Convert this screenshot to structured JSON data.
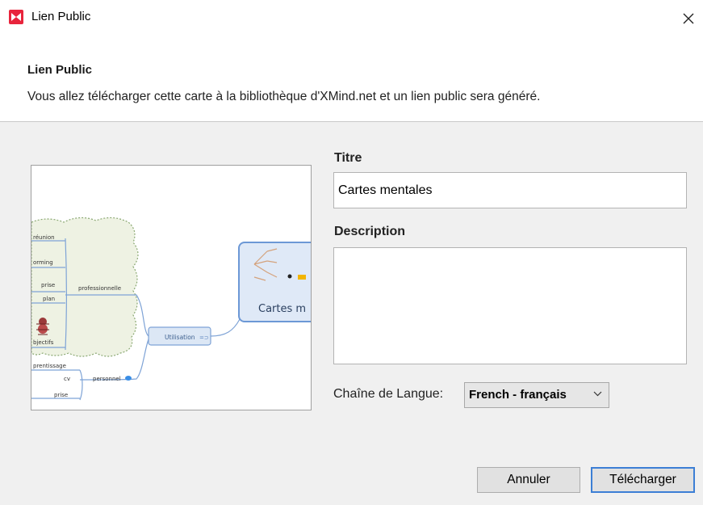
{
  "window": {
    "title": "Lien Public"
  },
  "header": {
    "title": "Lien Public",
    "description": "Vous allez télécharger cette carte à la bibliothèque d'XMind.net et un lien public sera généré."
  },
  "preview": {
    "central_topic": "Cartes m",
    "branches": {
      "utilisation": "Utilisation",
      "professionnelle": "professionnelle",
      "personnel": "personnel"
    },
    "leaves": [
      "réunion",
      "orming",
      "prise",
      "plan",
      "bjectifs",
      "prentissage",
      "cv",
      "prise"
    ]
  },
  "form": {
    "title_label": "Titre",
    "title_value": "Cartes mentales",
    "description_label": "Description",
    "description_value": "",
    "language_label": "Chaîne de Langue:",
    "language_value": "French - français"
  },
  "buttons": {
    "cancel": "Annuler",
    "upload": "Télécharger"
  }
}
